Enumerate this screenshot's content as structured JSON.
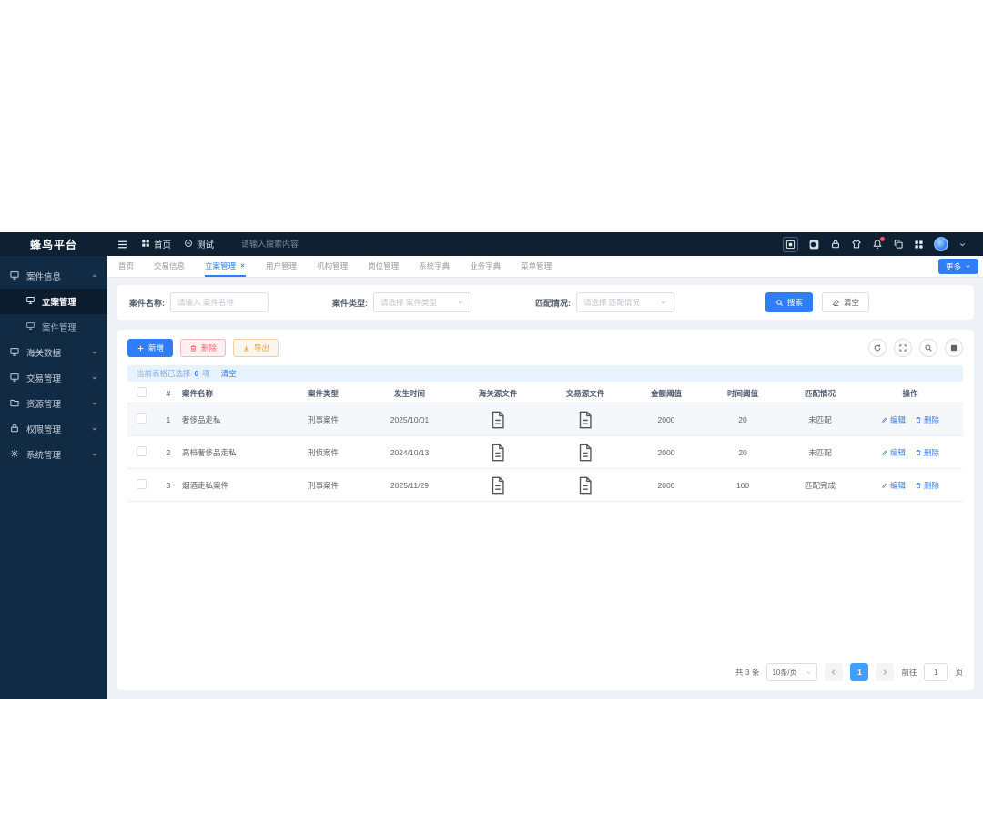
{
  "header": {
    "logo": "蜂鸟平台",
    "nav": [
      {
        "label": "首页"
      },
      {
        "label": "测试"
      }
    ],
    "search_placeholder": "请输入搜索内容",
    "right_icons": [
      "fullscreen-icon",
      "theme-toggle-icon",
      "lock-icon",
      "skin-icon",
      "notification-bell-icon",
      "copy-icon",
      "apps-grid-icon",
      "user-avatar",
      "chevron-down-icon"
    ]
  },
  "sidebar": {
    "items": [
      {
        "label": "案件信息"
      },
      {
        "label": "立案管理"
      },
      {
        "label": "案件管理"
      },
      {
        "label": "海关数据"
      },
      {
        "label": "交易管理"
      },
      {
        "label": "资源管理"
      },
      {
        "label": "权限管理"
      },
      {
        "label": "系统管理"
      }
    ]
  },
  "tabs": {
    "items": [
      {
        "label": "首页"
      },
      {
        "label": "交易信息"
      },
      {
        "label": "立案管理",
        "active": true,
        "closable": true
      },
      {
        "label": "用户管理"
      },
      {
        "label": "机构管理"
      },
      {
        "label": "岗位管理"
      },
      {
        "label": "系统字典"
      },
      {
        "label": "业务字典"
      },
      {
        "label": "菜单管理"
      }
    ],
    "more_label": "更多"
  },
  "filter": {
    "name_label": "案件名称:",
    "name_placeholder": "请输入 案件名称",
    "type_label": "案件类型:",
    "type_placeholder": "请选择 案件类型",
    "match_label": "匹配情况:",
    "match_placeholder": "请选择 匹配情况",
    "search_label": "搜索",
    "clear_label": "清空"
  },
  "toolbar": {
    "add_label": "新增",
    "delete_label": "删除",
    "export_label": "导出",
    "icon_buttons": [
      "refresh-icon",
      "maximize-icon",
      "search-icon",
      "column-settings-icon"
    ]
  },
  "selection": {
    "prefix": "当前表格已选择",
    "count": "0",
    "unit": "项",
    "clear_label": "清空"
  },
  "table": {
    "headers": [
      "#",
      "案件名称",
      "案件类型",
      "发生时间",
      "海关源文件",
      "交易源文件",
      "金额阈值",
      "时间阈值",
      "匹配情况",
      "操作"
    ],
    "rows": [
      {
        "index": "1",
        "name": "奢侈品走私",
        "type": "刑事案件",
        "date": "2025/10/01",
        "amount": "2000",
        "time": "20",
        "match": "未匹配"
      },
      {
        "index": "2",
        "name": "高档奢侈品走私",
        "type": "刑侦案件",
        "date": "2024/10/13",
        "amount": "2000",
        "time": "20",
        "match": "未匹配"
      },
      {
        "index": "3",
        "name": "烟酒走私案件",
        "type": "刑事案件",
        "date": "2025/11/29",
        "amount": "2000",
        "time": "100",
        "match": "匹配完成"
      }
    ],
    "edit_label": "编辑",
    "delete_label": "删除"
  },
  "pagination": {
    "total": "共 3 条",
    "page_size": "10条/页",
    "current": "1",
    "goto_prefix": "前往",
    "goto_value": "1",
    "goto_suffix": "页"
  },
  "colors": {
    "accent": "#2f7ef7",
    "danger": "#f56c6c",
    "warning": "#e6a23c",
    "header_bg": "#0f2032",
    "sidebar_bg": "#122b44"
  }
}
